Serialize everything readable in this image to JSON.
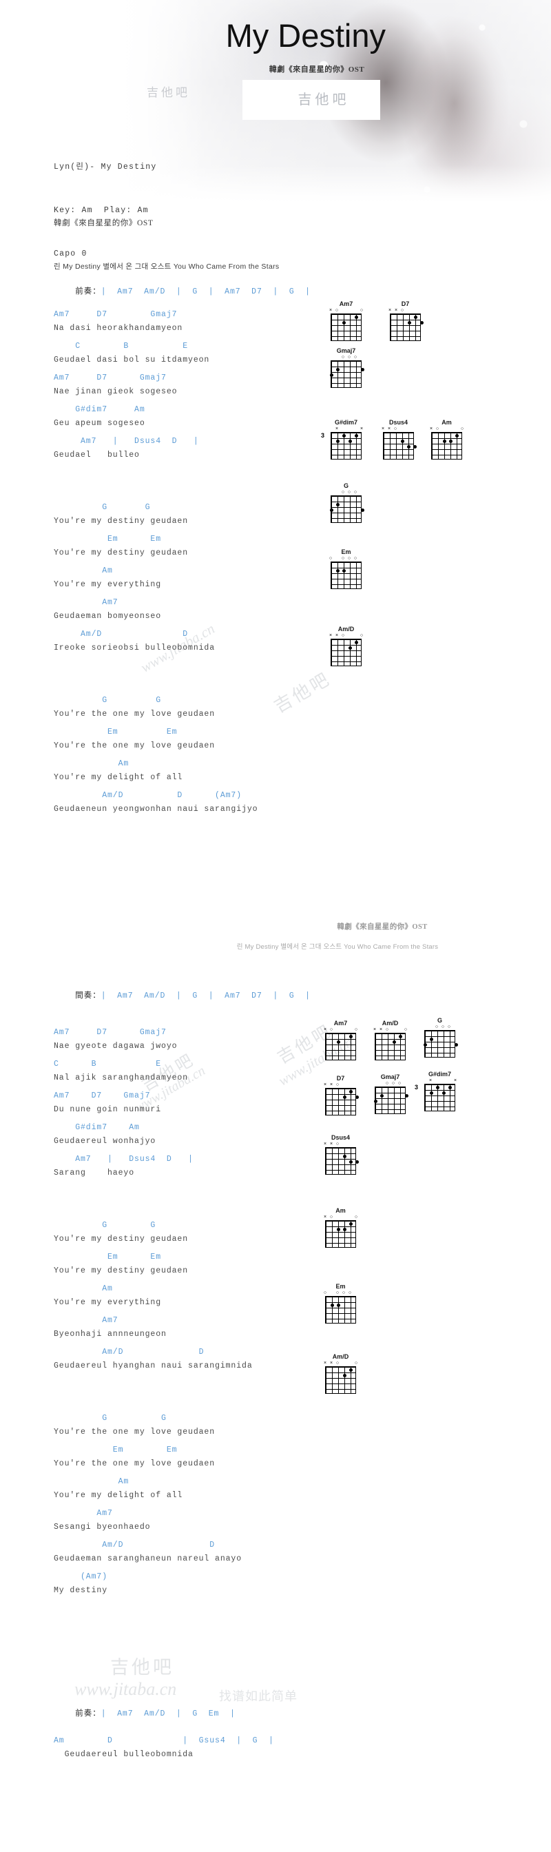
{
  "header": {
    "title": "My Destiny",
    "ost_label": "韓劇《來自星星的你》OST",
    "site_watermark": "吉他吧"
  },
  "info": {
    "artist_line": "Lyn(린)- My Destiny",
    "key_line": "Key: Am  Play: Am",
    "capo_line": "Capo 0"
  },
  "subtitle": {
    "cn_line": "韓劇《來自星星的你》OST",
    "kr_line": "린 My Destiny 별에서 온 그대 오스트 You Who Came From the Stars"
  },
  "mid_banner": {
    "cn_line": "韓劇《來自星星的你》OST",
    "kr_line": "린 My Destiny 별에서 온 그대 오스트 You Who Came From the Stars"
  },
  "watermarks": {
    "cn": "吉他吧",
    "url": "www.jitaba.cn",
    "tagline": "找谱如此简单"
  },
  "sections": {
    "intro1": {
      "label": "前奏：",
      "progression": "|  Am7  Am/D  |  G  |  Am7  D7  |  G  |"
    },
    "interlude": {
      "label": "間奏：",
      "progression": "|  Am7  Am/D  |  G  |  Am7  D7  |  G  |"
    },
    "outro": {
      "label": "前奏：",
      "progression": "|  Am7  Am/D  |  G  Em  |"
    }
  },
  "verse1": [
    {
      "chords": "Am7     D7        Gmaj7",
      "lyric": "Na dasi heorakhandamyeon"
    },
    {
      "chords": "    C        B          E",
      "lyric": "Geudael dasi bol su itdamyeon"
    },
    {
      "chords": "Am7     D7      Gmaj7",
      "lyric": "Nae jinan gieok sogeseo"
    },
    {
      "chords": "    G#dim7     Am",
      "lyric": "Geu apeum sogeseo"
    },
    {
      "chords": "     Am7   |   Dsus4  D   |",
      "lyric": "Geudael   bulleo"
    }
  ],
  "chorus1a": [
    {
      "chords": "         G       G",
      "lyric": "You're my destiny geudaen"
    },
    {
      "chords": "          Em      Em",
      "lyric": "You're my destiny geudaen"
    },
    {
      "chords": "         Am",
      "lyric": "You're my everything"
    },
    {
      "chords": "         Am7",
      "lyric": "Geudaeman bomyeonseo"
    },
    {
      "chords": "     Am/D               D",
      "lyric": "Ireoke sorieobsi bulleobomnida"
    }
  ],
  "chorus1b": [
    {
      "chords": "         G         G",
      "lyric": "You're the one my love geudaen"
    },
    {
      "chords": "          Em         Em",
      "lyric": "You're the one my love geudaen"
    },
    {
      "chords": "            Am",
      "lyric": "You're my delight of all"
    },
    {
      "chords": "         Am/D          D      (Am7)",
      "lyric": "Geudaeneun yeongwonhan naui sarangijyo"
    }
  ],
  "verse2": [
    {
      "chords": "Am7     D7      Gmaj7",
      "lyric": "Nae gyeote dagawa jwoyo"
    },
    {
      "chords": "C      B           E",
      "lyric": "Nal ajik saranghandamyeon"
    },
    {
      "chords": "Am7    D7    Gmaj7",
      "lyric": "Du nune goin nunmuri"
    },
    {
      "chords": "    G#dim7    Am",
      "lyric": "Geudaereul wonhajyo"
    },
    {
      "chords": "    Am7   |   Dsus4  D   |",
      "lyric": "Sarang    haeyo"
    }
  ],
  "chorus2a": [
    {
      "chords": "         G        G",
      "lyric": "You're my destiny geudaen"
    },
    {
      "chords": "          Em      Em",
      "lyric": "You're my destiny geudaen"
    },
    {
      "chords": "         Am",
      "lyric": "You're my everything"
    },
    {
      "chords": "         Am7",
      "lyric": "Byeonhaji annneungeon"
    },
    {
      "chords": "         Am/D              D",
      "lyric": "Geudaereul hyanghan naui sarangimnida"
    }
  ],
  "chorus2b": [
    {
      "chords": "         G          G",
      "lyric": "You're the one my love geudaen"
    },
    {
      "chords": "           Em        Em",
      "lyric": "You're the one my love geudaen"
    },
    {
      "chords": "            Am",
      "lyric": "You're my delight of all"
    },
    {
      "chords": "        Am7",
      "lyric": "Sesangi byeonhaedo"
    },
    {
      "chords": "         Am/D                D",
      "lyric": "Geudaeman saranghaneun nareul anayo"
    },
    {
      "chords": "     (Am7)",
      "lyric": "My destiny"
    }
  ],
  "outro_lines": [
    {
      "chords": "Am        D             |  Gsus4  |  G  |",
      "lyric": "  Geudaereul bulleobomnida"
    }
  ],
  "chord_diagrams_group1": [
    {
      "name": "Am7",
      "marks": "x o     o",
      "fret": ""
    },
    {
      "name": "D7",
      "marks": "x x o",
      "fret": ""
    },
    {
      "name": "Gmaj7",
      "marks": "  o o o",
      "fret": ""
    },
    {
      "name": "G#dim7",
      "marks": " x     x",
      "fret": "3"
    },
    {
      "name": "Dsus4",
      "marks": "x x o",
      "fret": ""
    },
    {
      "name": "Am",
      "marks": "x o     o",
      "fret": ""
    },
    {
      "name": "G",
      "marks": "  o o o",
      "fret": ""
    },
    {
      "name": "Em",
      "marks": "o   o o o",
      "fret": ""
    },
    {
      "name": "Am/D",
      "marks": "x x o   o",
      "fret": ""
    }
  ],
  "chord_diagrams_group2": [
    {
      "name": "Am7",
      "marks": "x o     o",
      "fret": ""
    },
    {
      "name": "Am/D",
      "marks": "x x o   o",
      "fret": ""
    },
    {
      "name": "G",
      "marks": "  o o o",
      "fret": ""
    },
    {
      "name": "D7",
      "marks": "x x o",
      "fret": ""
    },
    {
      "name": "Gmaj7",
      "marks": "  o o o",
      "fret": ""
    },
    {
      "name": "G#dim7",
      "marks": " x     x",
      "fret": "3"
    },
    {
      "name": "Dsus4",
      "marks": "x x o",
      "fret": ""
    },
    {
      "name": "Am",
      "marks": "x o     o",
      "fret": ""
    },
    {
      "name": "Em",
      "marks": "o   o o o",
      "fret": ""
    },
    {
      "name": "Am/D",
      "marks": "x x o   o",
      "fret": ""
    }
  ],
  "colors": {
    "chord": "#5b9bd5",
    "lyric": "#4a4a4a",
    "watermark": "#a8acb2"
  }
}
